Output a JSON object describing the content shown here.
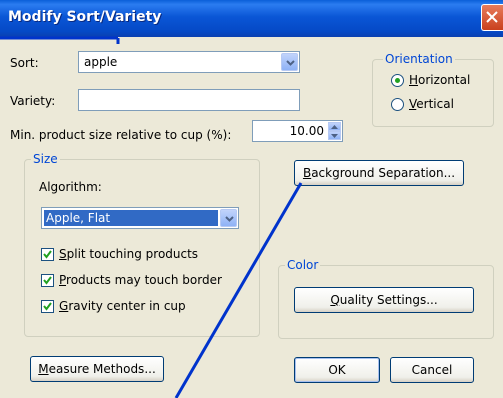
{
  "window": {
    "title": "Modify Sort/Variety"
  },
  "sort": {
    "label": "Sort:",
    "value": "apple"
  },
  "variety": {
    "label": "Variety:",
    "value": ""
  },
  "min_size": {
    "label": "Min. product size relative to cup (%):",
    "value": "10.00"
  },
  "orientation": {
    "title": "Orientation",
    "horizontal": {
      "key": "H",
      "rest": "orizontal",
      "selected": true
    },
    "vertical": {
      "key": "V",
      "rest": "ertical",
      "selected": false
    }
  },
  "size_group": {
    "title": "Size",
    "algorithm_label": "Algorithm:",
    "algorithm_value": "Apple, Flat",
    "split": {
      "key": "S",
      "rest": "plit touching products",
      "checked": true
    },
    "touch": {
      "key": "P",
      "rest": "roducts may touch border",
      "checked": true
    },
    "gravity": {
      "key": "G",
      "rest": "ravity center in cup",
      "checked": true
    }
  },
  "buttons": {
    "background_separation": {
      "key": "B",
      "rest": "ackground Separation..."
    },
    "quality_settings": {
      "key": "Q",
      "rest": "uality Settings..."
    },
    "measure_methods": {
      "key": "M",
      "rest": "easure Methods..."
    },
    "ok": "OK",
    "cancel": "Cancel"
  },
  "color_group": {
    "title": "Color"
  },
  "colors": {
    "titlebar": "#0a56d6",
    "accent": "#0046d5",
    "selection": "#316ac5",
    "annotation_line": "#0033cc"
  }
}
